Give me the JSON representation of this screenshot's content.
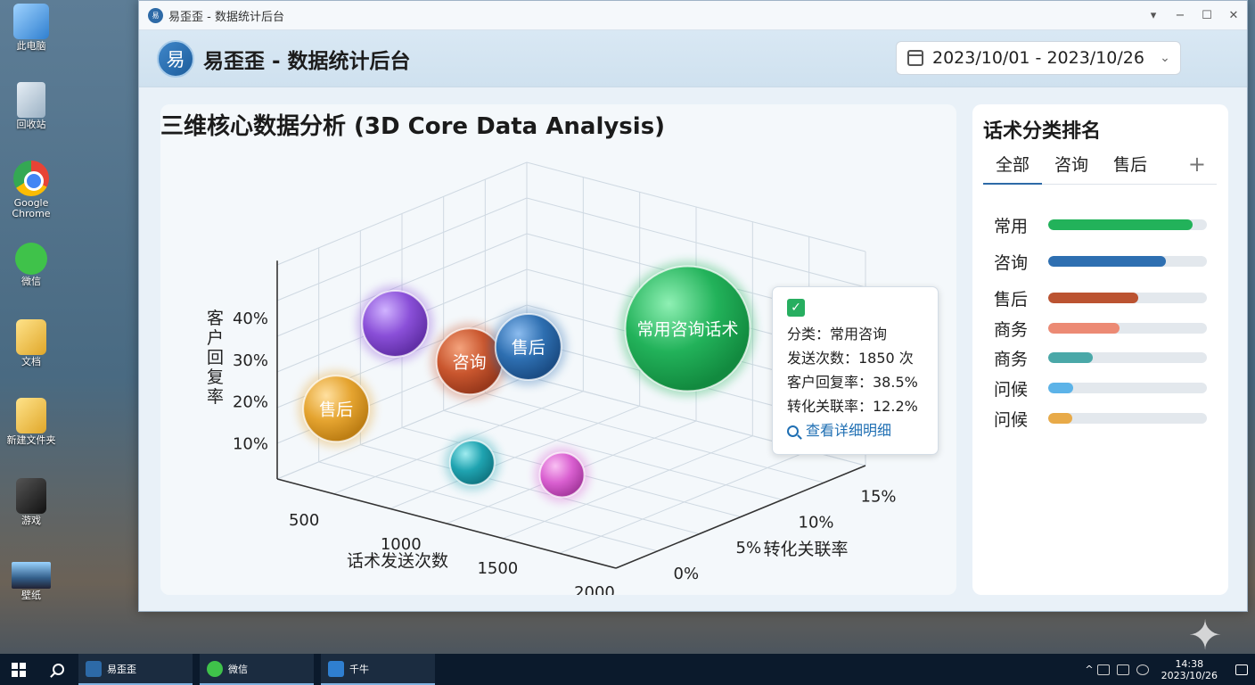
{
  "desktop": {
    "icons": [
      {
        "label": "此电脑",
        "icon": "computer-icon"
      },
      {
        "label": "回收站",
        "icon": "recycle-bin-icon"
      },
      {
        "label": "Google Chrome",
        "icon": "chrome-icon"
      },
      {
        "label": "微信",
        "icon": "wechat-icon"
      },
      {
        "label": "文档",
        "icon": "folder-icon"
      },
      {
        "label": "新建文件夹",
        "icon": "folder-icon"
      },
      {
        "label": "游戏",
        "icon": "game-icon"
      },
      {
        "label": "壁纸",
        "icon": "image-icon"
      }
    ]
  },
  "window": {
    "title": "易歪歪 - 数据统计后台",
    "icon_text": "易",
    "controls": [
      "▾",
      "−",
      "☐",
      "✕"
    ]
  },
  "header": {
    "logo_text": "易",
    "app_title": "易歪歪 - 数据统计后台",
    "date_range": "2023/10/01 - 2023/10/26"
  },
  "main": {
    "title": "三维核心数据分析 (3D Core Data Analysis)"
  },
  "chart_data": {
    "type": "scatter",
    "subtype": "3d-bubble",
    "title": "三维核心数据分析 (3D Core Data Analysis)",
    "xlabel": "话术发送次数",
    "ylabel": "转化关联率",
    "zlabel": "客户回复率",
    "x_ticks": [
      "500",
      "1000",
      "1500",
      "2000"
    ],
    "y_ticks": [
      "0%",
      "5%",
      "10%",
      "15%"
    ],
    "z_ticks": [
      "10%",
      "20%",
      "30%",
      "40%"
    ],
    "series": [
      {
        "label": "常用咨询话术",
        "x": 1850,
        "y": 12.2,
        "z": 38.5,
        "color": "#22b25a",
        "size": "large"
      },
      {
        "label": "咨询",
        "x": 1000,
        "y": 6,
        "z": 30,
        "color": "#c9562e",
        "size": "medium"
      },
      {
        "label": "售后",
        "x": 1200,
        "y": 8,
        "z": 33,
        "color": "#2e6fb1",
        "size": "medium"
      },
      {
        "label": "售后",
        "x": 500,
        "y": 2,
        "z": 18,
        "color": "#e5a430",
        "size": "medium"
      },
      {
        "label": "",
        "x": 700,
        "y": 4,
        "z": 40,
        "color": "#8a4fd8",
        "size": "medium"
      },
      {
        "label": "",
        "x": 1200,
        "y": 4,
        "z": 8,
        "color": "#1fa3b0",
        "size": "small"
      },
      {
        "label": "",
        "x": 1600,
        "y": 6,
        "z": 6,
        "color": "#d95fd0",
        "size": "small"
      }
    ]
  },
  "tooltip": {
    "line1": "分类：常用咨询",
    "line2": "发送次数：1850 次",
    "line3": "客户回复率：38.5%",
    "line4": "转化关联率：12.2%",
    "link": "查看详细明细"
  },
  "side": {
    "title": "话术分类排名",
    "tabs": [
      "全部",
      "咨询",
      "售后"
    ],
    "add_label": "+",
    "ranking": [
      {
        "label": "常用",
        "value": 0.91,
        "color": "#22b25a"
      },
      {
        "label": "咨询",
        "value": 0.74,
        "color": "#2e6fb1"
      },
      {
        "label": "售后",
        "value": 0.57,
        "color": "#bb5331"
      },
      {
        "label": "商务",
        "value": 0.45,
        "color": "#ec8a74"
      },
      {
        "label": "商务",
        "value": 0.28,
        "color": "#4aa8a8"
      },
      {
        "label": "问候",
        "value": 0.16,
        "color": "#5cb3e8"
      },
      {
        "label": "问候",
        "value": 0.15,
        "color": "#e8aa48"
      }
    ]
  },
  "taskbar": {
    "apps": [
      {
        "label": "易歪歪",
        "color": "#2d6aa7"
      },
      {
        "label": "微信",
        "color": "#3fc24a"
      },
      {
        "label": "千牛",
        "color": "#2f7fd0"
      }
    ],
    "time": "14:38",
    "date": "2023/10/26"
  }
}
